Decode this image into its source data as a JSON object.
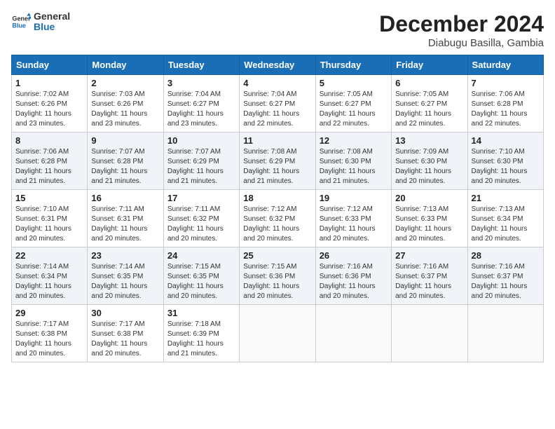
{
  "logo": {
    "line1": "General",
    "line2": "Blue"
  },
  "title": "December 2024",
  "subtitle": "Diabugu Basilla, Gambia",
  "weekdays": [
    "Sunday",
    "Monday",
    "Tuesday",
    "Wednesday",
    "Thursday",
    "Friday",
    "Saturday"
  ],
  "weeks": [
    [
      {
        "day": "1",
        "sunrise": "7:02 AM",
        "sunset": "6:26 PM",
        "daylight": "11 hours and 23 minutes."
      },
      {
        "day": "2",
        "sunrise": "7:03 AM",
        "sunset": "6:26 PM",
        "daylight": "11 hours and 23 minutes."
      },
      {
        "day": "3",
        "sunrise": "7:04 AM",
        "sunset": "6:27 PM",
        "daylight": "11 hours and 23 minutes."
      },
      {
        "day": "4",
        "sunrise": "7:04 AM",
        "sunset": "6:27 PM",
        "daylight": "11 hours and 22 minutes."
      },
      {
        "day": "5",
        "sunrise": "7:05 AM",
        "sunset": "6:27 PM",
        "daylight": "11 hours and 22 minutes."
      },
      {
        "day": "6",
        "sunrise": "7:05 AM",
        "sunset": "6:27 PM",
        "daylight": "11 hours and 22 minutes."
      },
      {
        "day": "7",
        "sunrise": "7:06 AM",
        "sunset": "6:28 PM",
        "daylight": "11 hours and 22 minutes."
      }
    ],
    [
      {
        "day": "8",
        "sunrise": "7:06 AM",
        "sunset": "6:28 PM",
        "daylight": "11 hours and 21 minutes."
      },
      {
        "day": "9",
        "sunrise": "7:07 AM",
        "sunset": "6:28 PM",
        "daylight": "11 hours and 21 minutes."
      },
      {
        "day": "10",
        "sunrise": "7:07 AM",
        "sunset": "6:29 PM",
        "daylight": "11 hours and 21 minutes."
      },
      {
        "day": "11",
        "sunrise": "7:08 AM",
        "sunset": "6:29 PM",
        "daylight": "11 hours and 21 minutes."
      },
      {
        "day": "12",
        "sunrise": "7:08 AM",
        "sunset": "6:30 PM",
        "daylight": "11 hours and 21 minutes."
      },
      {
        "day": "13",
        "sunrise": "7:09 AM",
        "sunset": "6:30 PM",
        "daylight": "11 hours and 20 minutes."
      },
      {
        "day": "14",
        "sunrise": "7:10 AM",
        "sunset": "6:30 PM",
        "daylight": "11 hours and 20 minutes."
      }
    ],
    [
      {
        "day": "15",
        "sunrise": "7:10 AM",
        "sunset": "6:31 PM",
        "daylight": "11 hours and 20 minutes."
      },
      {
        "day": "16",
        "sunrise": "7:11 AM",
        "sunset": "6:31 PM",
        "daylight": "11 hours and 20 minutes."
      },
      {
        "day": "17",
        "sunrise": "7:11 AM",
        "sunset": "6:32 PM",
        "daylight": "11 hours and 20 minutes."
      },
      {
        "day": "18",
        "sunrise": "7:12 AM",
        "sunset": "6:32 PM",
        "daylight": "11 hours and 20 minutes."
      },
      {
        "day": "19",
        "sunrise": "7:12 AM",
        "sunset": "6:33 PM",
        "daylight": "11 hours and 20 minutes."
      },
      {
        "day": "20",
        "sunrise": "7:13 AM",
        "sunset": "6:33 PM",
        "daylight": "11 hours and 20 minutes."
      },
      {
        "day": "21",
        "sunrise": "7:13 AM",
        "sunset": "6:34 PM",
        "daylight": "11 hours and 20 minutes."
      }
    ],
    [
      {
        "day": "22",
        "sunrise": "7:14 AM",
        "sunset": "6:34 PM",
        "daylight": "11 hours and 20 minutes."
      },
      {
        "day": "23",
        "sunrise": "7:14 AM",
        "sunset": "6:35 PM",
        "daylight": "11 hours and 20 minutes."
      },
      {
        "day": "24",
        "sunrise": "7:15 AM",
        "sunset": "6:35 PM",
        "daylight": "11 hours and 20 minutes."
      },
      {
        "day": "25",
        "sunrise": "7:15 AM",
        "sunset": "6:36 PM",
        "daylight": "11 hours and 20 minutes."
      },
      {
        "day": "26",
        "sunrise": "7:16 AM",
        "sunset": "6:36 PM",
        "daylight": "11 hours and 20 minutes."
      },
      {
        "day": "27",
        "sunrise": "7:16 AM",
        "sunset": "6:37 PM",
        "daylight": "11 hours and 20 minutes."
      },
      {
        "day": "28",
        "sunrise": "7:16 AM",
        "sunset": "6:37 PM",
        "daylight": "11 hours and 20 minutes."
      }
    ],
    [
      {
        "day": "29",
        "sunrise": "7:17 AM",
        "sunset": "6:38 PM",
        "daylight": "11 hours and 20 minutes."
      },
      {
        "day": "30",
        "sunrise": "7:17 AM",
        "sunset": "6:38 PM",
        "daylight": "11 hours and 20 minutes."
      },
      {
        "day": "31",
        "sunrise": "7:18 AM",
        "sunset": "6:39 PM",
        "daylight": "11 hours and 21 minutes."
      },
      null,
      null,
      null,
      null
    ]
  ]
}
